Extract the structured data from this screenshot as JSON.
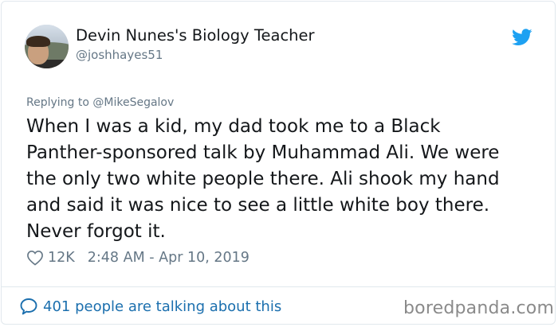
{
  "author": {
    "display_name": "Devin Nunes's Biology Teacher",
    "handle": "@joshhayes51"
  },
  "icons": {
    "brand": "twitter-bird-icon",
    "like": "heart-icon",
    "conversation": "speech-bubble-icon"
  },
  "colors": {
    "twitter_blue": "#1da1f2",
    "link_blue": "#1b6fae",
    "secondary_text": "#657786",
    "primary_text": "#14171a"
  },
  "tweet": {
    "replying_to": "Replying to @MikeSegalov",
    "lines": [
      "When I was a kid, my dad took me to a Black",
      "Panther-sponsored talk by Muhammad Ali. We were",
      "the only two white people there. Ali shook my hand",
      "and said it was nice to see a little white boy there.",
      "Never forgot it."
    ],
    "likes": "12K",
    "timestamp": "2:48 AM - Apr 10, 2019"
  },
  "footer": {
    "talking": "401 people are talking about this",
    "watermark": "boredpanda.com"
  }
}
